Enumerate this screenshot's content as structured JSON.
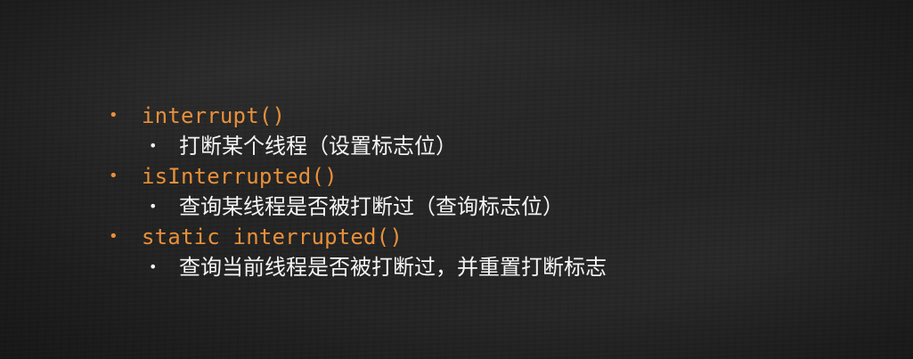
{
  "colors": {
    "accent": "#e8903a",
    "text": "#f4f4f4",
    "background": "#222222"
  },
  "bullet_glyph": "•",
  "items": [
    {
      "method": "interrupt()",
      "description": "打断某个线程（设置标志位）"
    },
    {
      "method": "isInterrupted()",
      "description": "查询某线程是否被打断过（查询标志位）"
    },
    {
      "method": "static interrupted()",
      "description": "查询当前线程是否被打断过，并重置打断标志"
    }
  ]
}
